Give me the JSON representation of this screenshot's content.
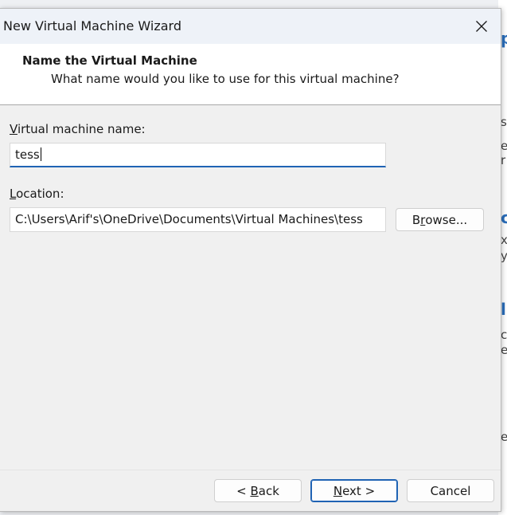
{
  "window": {
    "title": "New Virtual Machine Wizard"
  },
  "header": {
    "title": "Name the Virtual Machine",
    "subtitle": "What name would you like to use for this virtual machine?"
  },
  "form": {
    "name_label_mnemonic": "V",
    "name_label_rest": "irtual machine name:",
    "name_value": "tess",
    "location_label_mnemonic": "L",
    "location_label_rest": "ocation:",
    "location_value": "C:\\Users\\Arif's\\OneDrive\\Documents\\Virtual Machines\\tess",
    "browse_pre": "B",
    "browse_mnemonic": "r",
    "browse_post": "owse..."
  },
  "footer": {
    "back_pre": "< ",
    "back_mnemonic": "B",
    "back_post": "ack",
    "next_mnemonic": "N",
    "next_post": "ext >",
    "cancel_label": "Cancel"
  },
  "colors": {
    "accent": "#1f63b4",
    "header_bg": "#ffffff",
    "dialog_bg": "#f0f0f0"
  },
  "icons": {
    "close": "close-icon"
  }
}
